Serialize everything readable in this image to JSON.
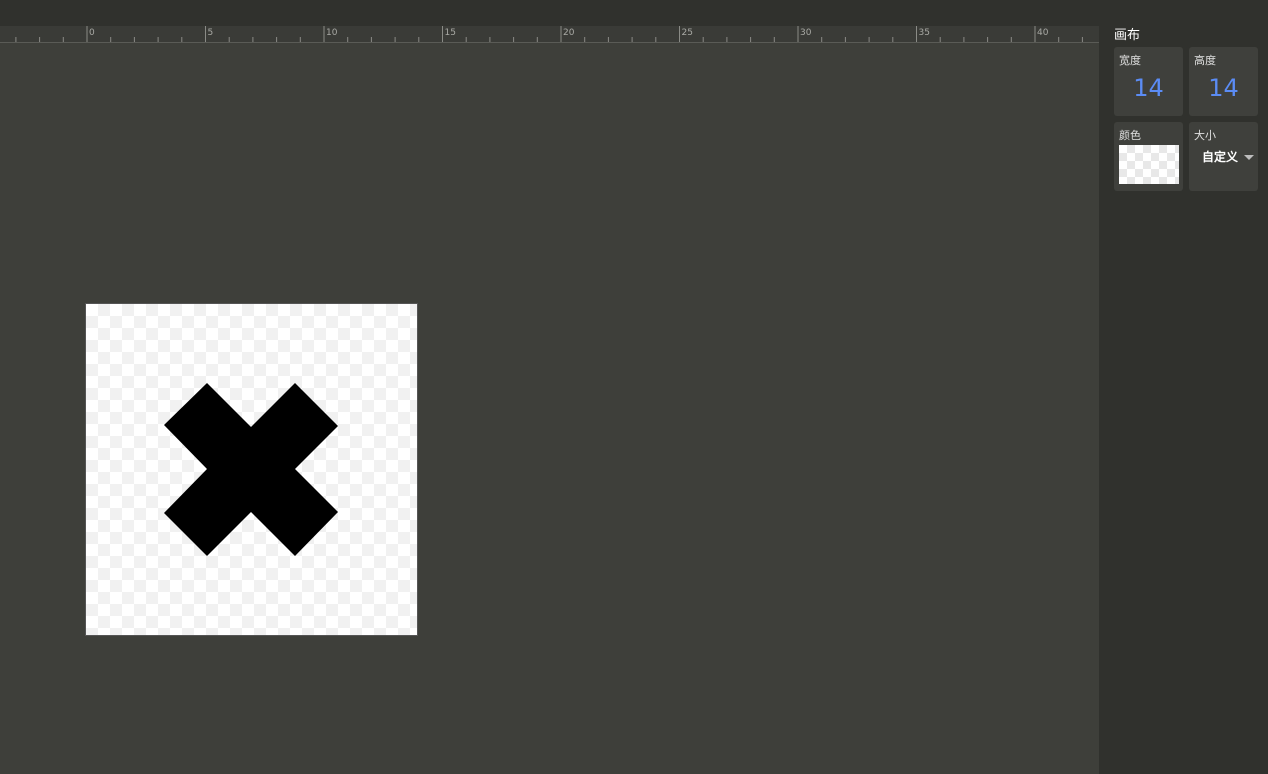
{
  "ruler": {
    "labels": [
      "0",
      "5",
      "10",
      "15",
      "20",
      "25",
      "30",
      "35",
      "40"
    ]
  },
  "panel": {
    "title": "画布",
    "width": {
      "label": "宽度",
      "value": "14"
    },
    "height": {
      "label": "高度",
      "value": "14"
    },
    "color": {
      "label": "颜色"
    },
    "size": {
      "label": "大小",
      "value": "自定义"
    }
  },
  "canvas": {
    "icon": "close-x-icon",
    "icon_color": "#000000",
    "accent_color": "#5b8cf5"
  }
}
